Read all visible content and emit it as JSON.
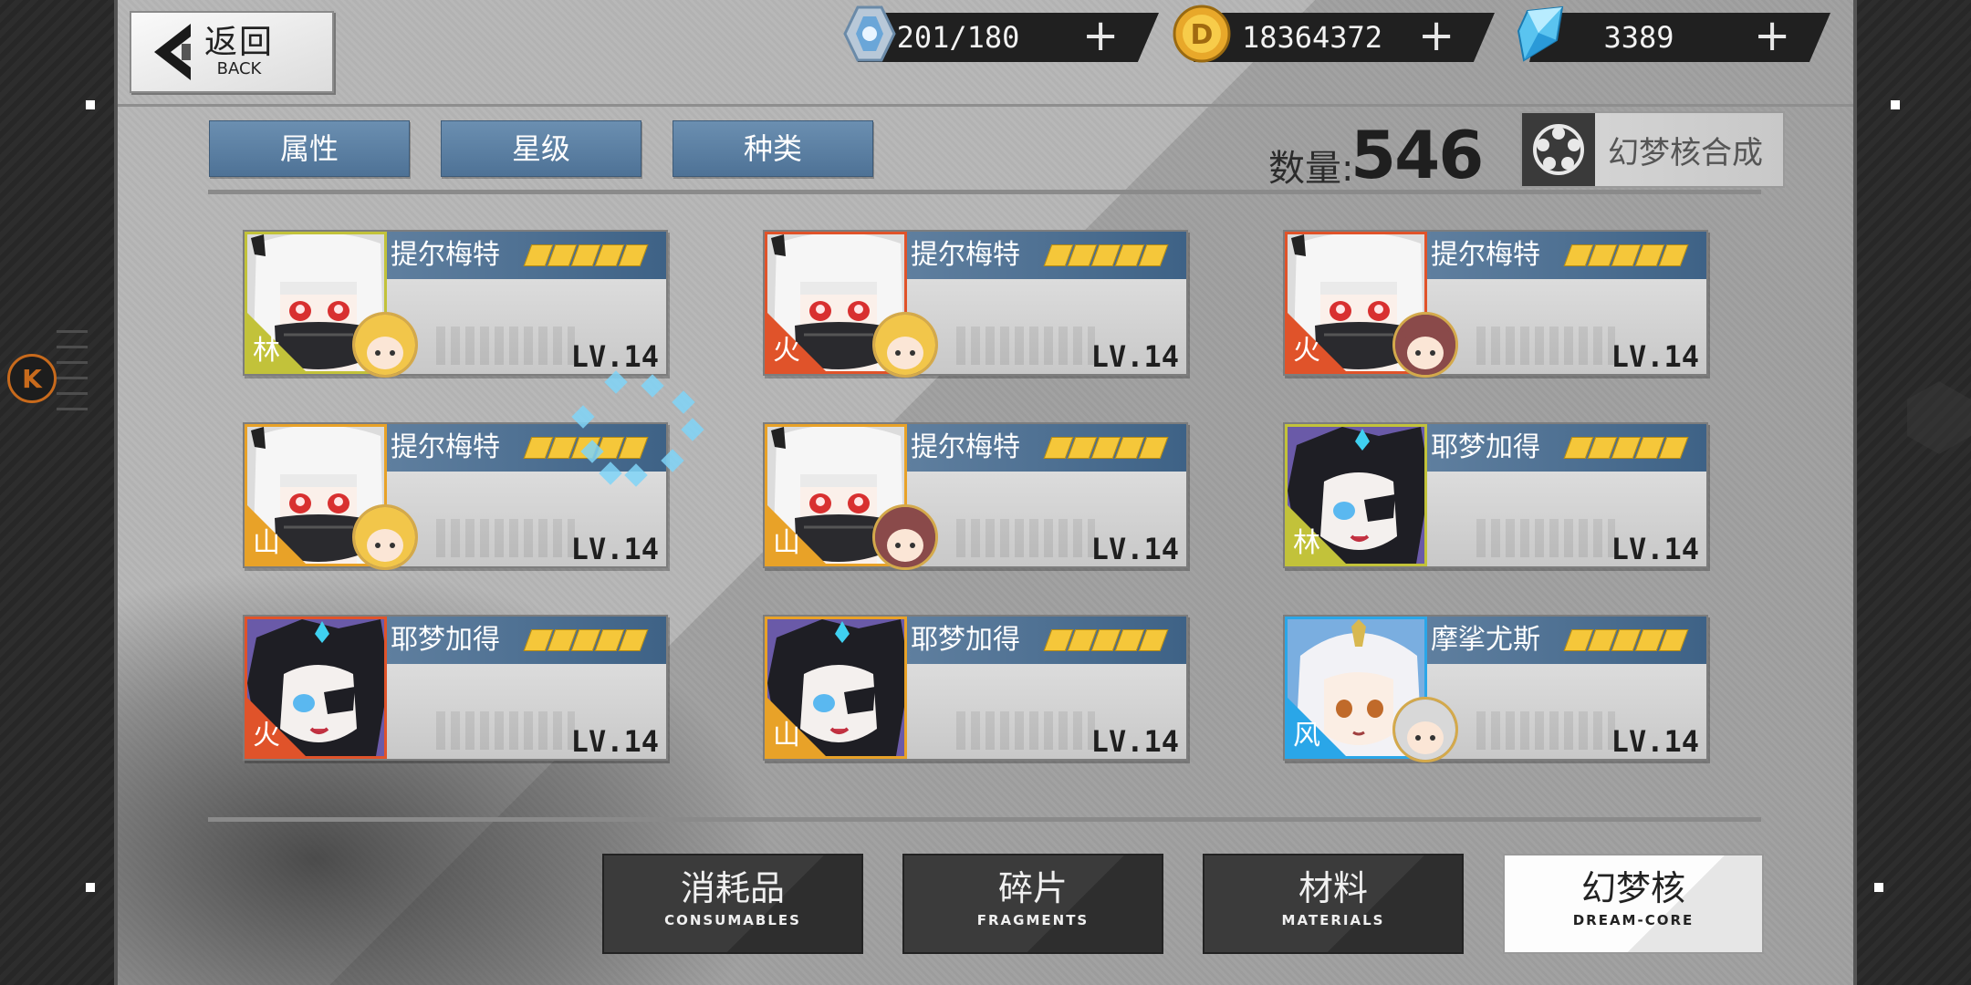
{
  "back": {
    "label_cn": "返回",
    "label_en": "BACK"
  },
  "resources": [
    {
      "name": "stamina",
      "icon": "stamina-crystal-icon",
      "value": "201/180"
    },
    {
      "name": "gold",
      "icon": "gold-coin-icon",
      "value": "18364372"
    },
    {
      "name": "diamond",
      "icon": "diamond-icon",
      "value": "3389"
    }
  ],
  "filters": [
    "属性",
    "星级",
    "种类"
  ],
  "count": {
    "label": "数量:",
    "value": "546"
  },
  "synthesis": {
    "label": "幻梦核合成",
    "icon": "flower-gear-icon"
  },
  "cards": [
    {
      "name": "提尔梅特",
      "element": "林",
      "level": "LV.14",
      "stars": 5,
      "color": "#c2c23a",
      "portrait": "white",
      "sub": "blonde"
    },
    {
      "name": "提尔梅特",
      "element": "火",
      "level": "LV.14",
      "stars": 5,
      "color": "#e0532a",
      "portrait": "white",
      "sub": "blonde"
    },
    {
      "name": "提尔梅特",
      "element": "火",
      "level": "LV.14",
      "stars": 5,
      "color": "#e0532a",
      "portrait": "white",
      "sub": "brown"
    },
    {
      "name": "提尔梅特",
      "element": "山",
      "level": "LV.14",
      "stars": 5,
      "color": "#e8a228",
      "portrait": "white",
      "sub": "blonde"
    },
    {
      "name": "提尔梅特",
      "element": "山",
      "level": "LV.14",
      "stars": 5,
      "color": "#e8a228",
      "portrait": "white",
      "sub": "brown"
    },
    {
      "name": "耶梦加得",
      "element": "林",
      "level": "LV.14",
      "stars": 5,
      "color": "#c2c23a",
      "portrait": "dark",
      "sub": ""
    },
    {
      "name": "耶梦加得",
      "element": "火",
      "level": "LV.14",
      "stars": 5,
      "color": "#e0532a",
      "portrait": "dark",
      "sub": ""
    },
    {
      "name": "耶梦加得",
      "element": "山",
      "level": "LV.14",
      "stars": 5,
      "color": "#e8a228",
      "portrait": "dark",
      "sub": ""
    },
    {
      "name": "摩挲尤斯",
      "element": "风",
      "level": "LV.14",
      "stars": 5,
      "color": "#2aa6e8",
      "portrait": "silver",
      "sub": "silver"
    }
  ],
  "tabs": [
    {
      "cn": "消耗品",
      "en": "CONSUMABLES",
      "active": false
    },
    {
      "cn": "碎片",
      "en": "FRAGMENTS",
      "active": false
    },
    {
      "cn": "材料",
      "en": "MATERIALS",
      "active": false
    },
    {
      "cn": "幻梦核",
      "en": "DREAM-CORE",
      "active": true
    }
  ]
}
